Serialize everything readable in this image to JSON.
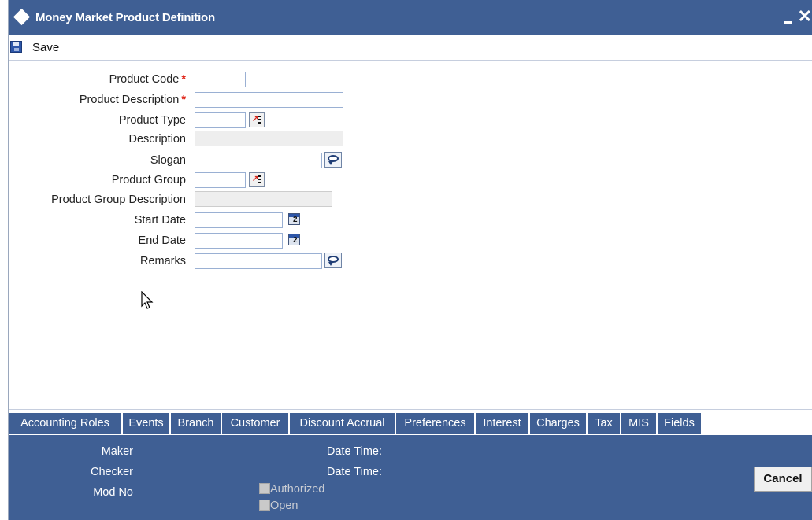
{
  "window": {
    "title": "Money Market Product Definition",
    "minimize_icon": "minimize-icon",
    "close_icon": "close-icon",
    "close_glyph": "✕"
  },
  "toolbar": {
    "save_label": "Save",
    "save_icon": "save-disk-icon"
  },
  "form": {
    "product_code_label": "Product Code",
    "product_description_label": "Product Description",
    "product_type_label": "Product Type",
    "description_label": "Description",
    "slogan_label": "Slogan",
    "product_group_label": "Product Group",
    "product_group_description_label": "Product Group Description",
    "start_date_label": "Start Date",
    "end_date_label": "End Date",
    "remarks_label": "Remarks",
    "required_marker": "*",
    "values": {
      "product_code": "",
      "product_description": "",
      "product_type": "",
      "description": "",
      "slogan": "",
      "product_group": "",
      "product_group_description": "",
      "start_date": "",
      "end_date": "",
      "remarks": ""
    },
    "calendar_icon_number": "2"
  },
  "tabs": [
    "Accounting Roles",
    "Events",
    "Branch",
    "Customer",
    "Discount Accrual",
    "Preferences",
    "Interest",
    "Charges",
    "Tax",
    "MIS",
    "Fields"
  ],
  "footer": {
    "maker_label": "Maker",
    "checker_label": "Checker",
    "mod_no_label": "Mod No",
    "date_time_label_1": "Date Time:",
    "date_time_label_2": "Date Time:",
    "authorized_label": "Authorized",
    "open_label": "Open",
    "cancel_label": "Cancel"
  },
  "colors": {
    "titlebar": "#3f5f94",
    "required": "#e0281c",
    "input_border": "#9ab0d3"
  }
}
